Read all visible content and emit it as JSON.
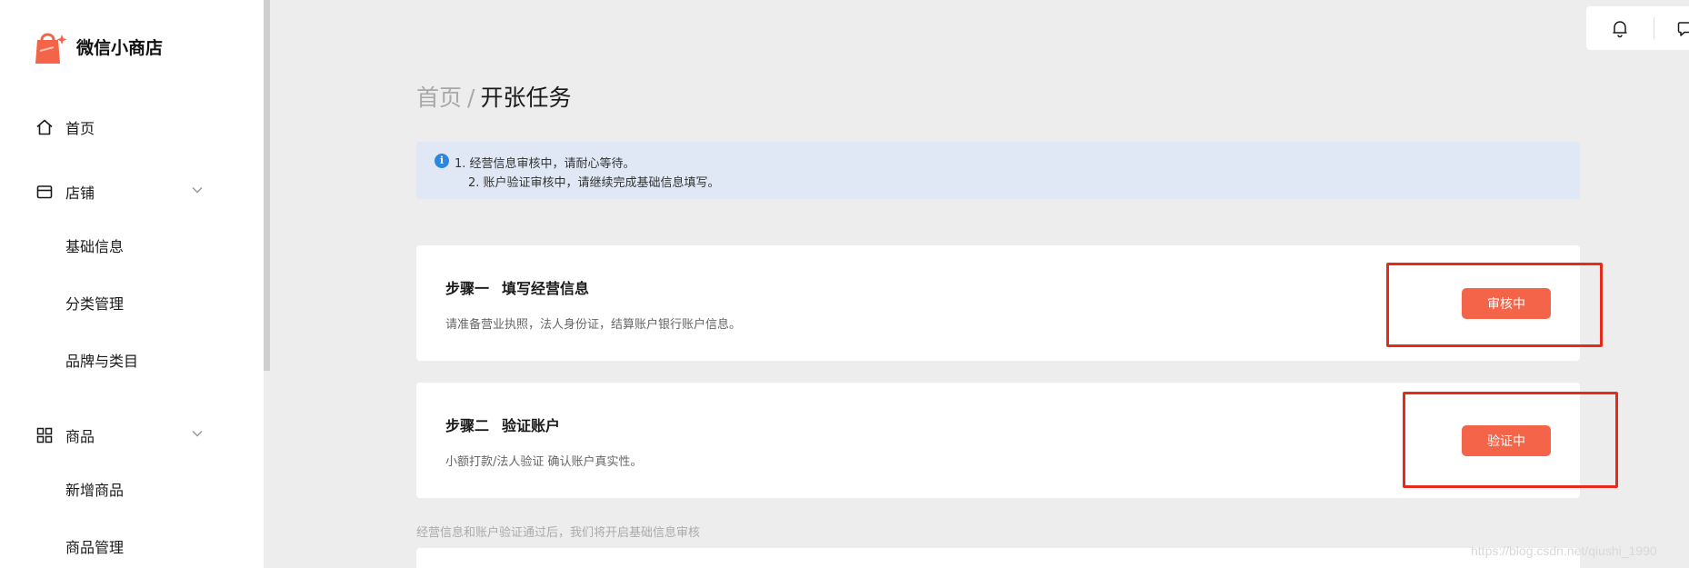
{
  "app": {
    "name": "微信小商店"
  },
  "sidebar": {
    "nav": [
      {
        "label": "首页",
        "icon": "home-icon"
      },
      {
        "label": "店铺",
        "icon": "store-icon",
        "expanded": true
      },
      {
        "label": "商品",
        "icon": "grid-icon",
        "expanded": true
      }
    ],
    "store_sub": [
      "基础信息",
      "分类管理",
      "品牌与类目"
    ],
    "goods_sub": [
      "新增商品",
      "商品管理"
    ]
  },
  "toolbar": {
    "icons": [
      "bell-icon",
      "chat-icon"
    ]
  },
  "breadcrumb": {
    "root": "首页",
    "separator": "/",
    "current": "开张任务"
  },
  "notice": {
    "icon": "info-icon",
    "lines": [
      "1. 经营信息审核中，请耐心等待。",
      "2. 账户验证审核中，请继续完成基础信息填写。"
    ]
  },
  "steps": [
    {
      "label": "步骤一",
      "title": "填写经营信息",
      "desc": "请准备营业执照，法人身份证，结算账户银行账户信息。",
      "status": "审核中"
    },
    {
      "label": "步骤二",
      "title": "验证账户",
      "desc": "小额打款/法人验证 确认账户真实性。",
      "status": "验证中"
    }
  ],
  "footer_note": "经营信息和账户验证通过后，我们将开启基础信息审核",
  "watermark": "https://blog.csdn.net/qiushi_1990",
  "colors": {
    "accent": "#f46449",
    "highlight": "#e8291c",
    "notice_bg": "#dfe8f4",
    "info": "#2e86de"
  }
}
